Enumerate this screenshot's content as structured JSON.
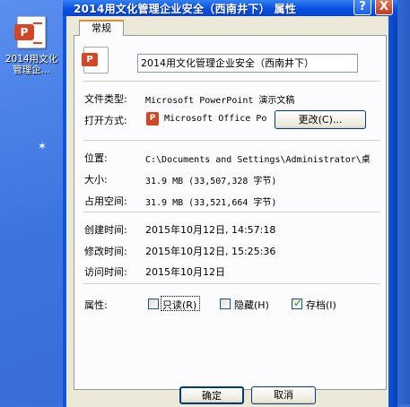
{
  "desktop": {
    "icon_label_line1": "2014用文化",
    "icon_label_line2": "管理企...",
    "icon_badge": "P"
  },
  "window": {
    "title": "2014用文化管理企业安全（西南井下）  属性",
    "help_glyph": "?",
    "close_glyph": "X"
  },
  "tabs": {
    "general": "常规"
  },
  "file": {
    "name": "2014用文化管理企业安全（西南井下）",
    "icon_badge": "P"
  },
  "fields": {
    "type_label": "文件类型:",
    "type_value": "Microsoft PowerPoint 演示文稿",
    "opens_label": "打开方式:",
    "opens_value": "Microsoft Office Po",
    "change_button": "更改(C)...",
    "location_label": "位置:",
    "location_value": "C:\\Documents and Settings\\Administrator\\桌",
    "size_label": "大小:",
    "size_value": "31.9 MB (33,507,328 字节)",
    "disk_label": "占用空间:",
    "disk_value": "31.9 MB (33,521,664 字节)",
    "created_label": "创建时间:",
    "created_value": "2015年10月12日, 14:57:18",
    "modified_label": "修改时间:",
    "modified_value": "2015年10月12日, 15:25:36",
    "accessed_label": "访问时间:",
    "accessed_value": "2015年10月12日"
  },
  "attributes": {
    "label": "属性:",
    "readonly": "只读(R)",
    "hidden": "隐藏(H)",
    "archive": "存档(I)",
    "readonly_checked": false,
    "hidden_checked": false,
    "archive_checked": true
  },
  "buttons": {
    "ok": "确定",
    "cancel": "取消"
  }
}
